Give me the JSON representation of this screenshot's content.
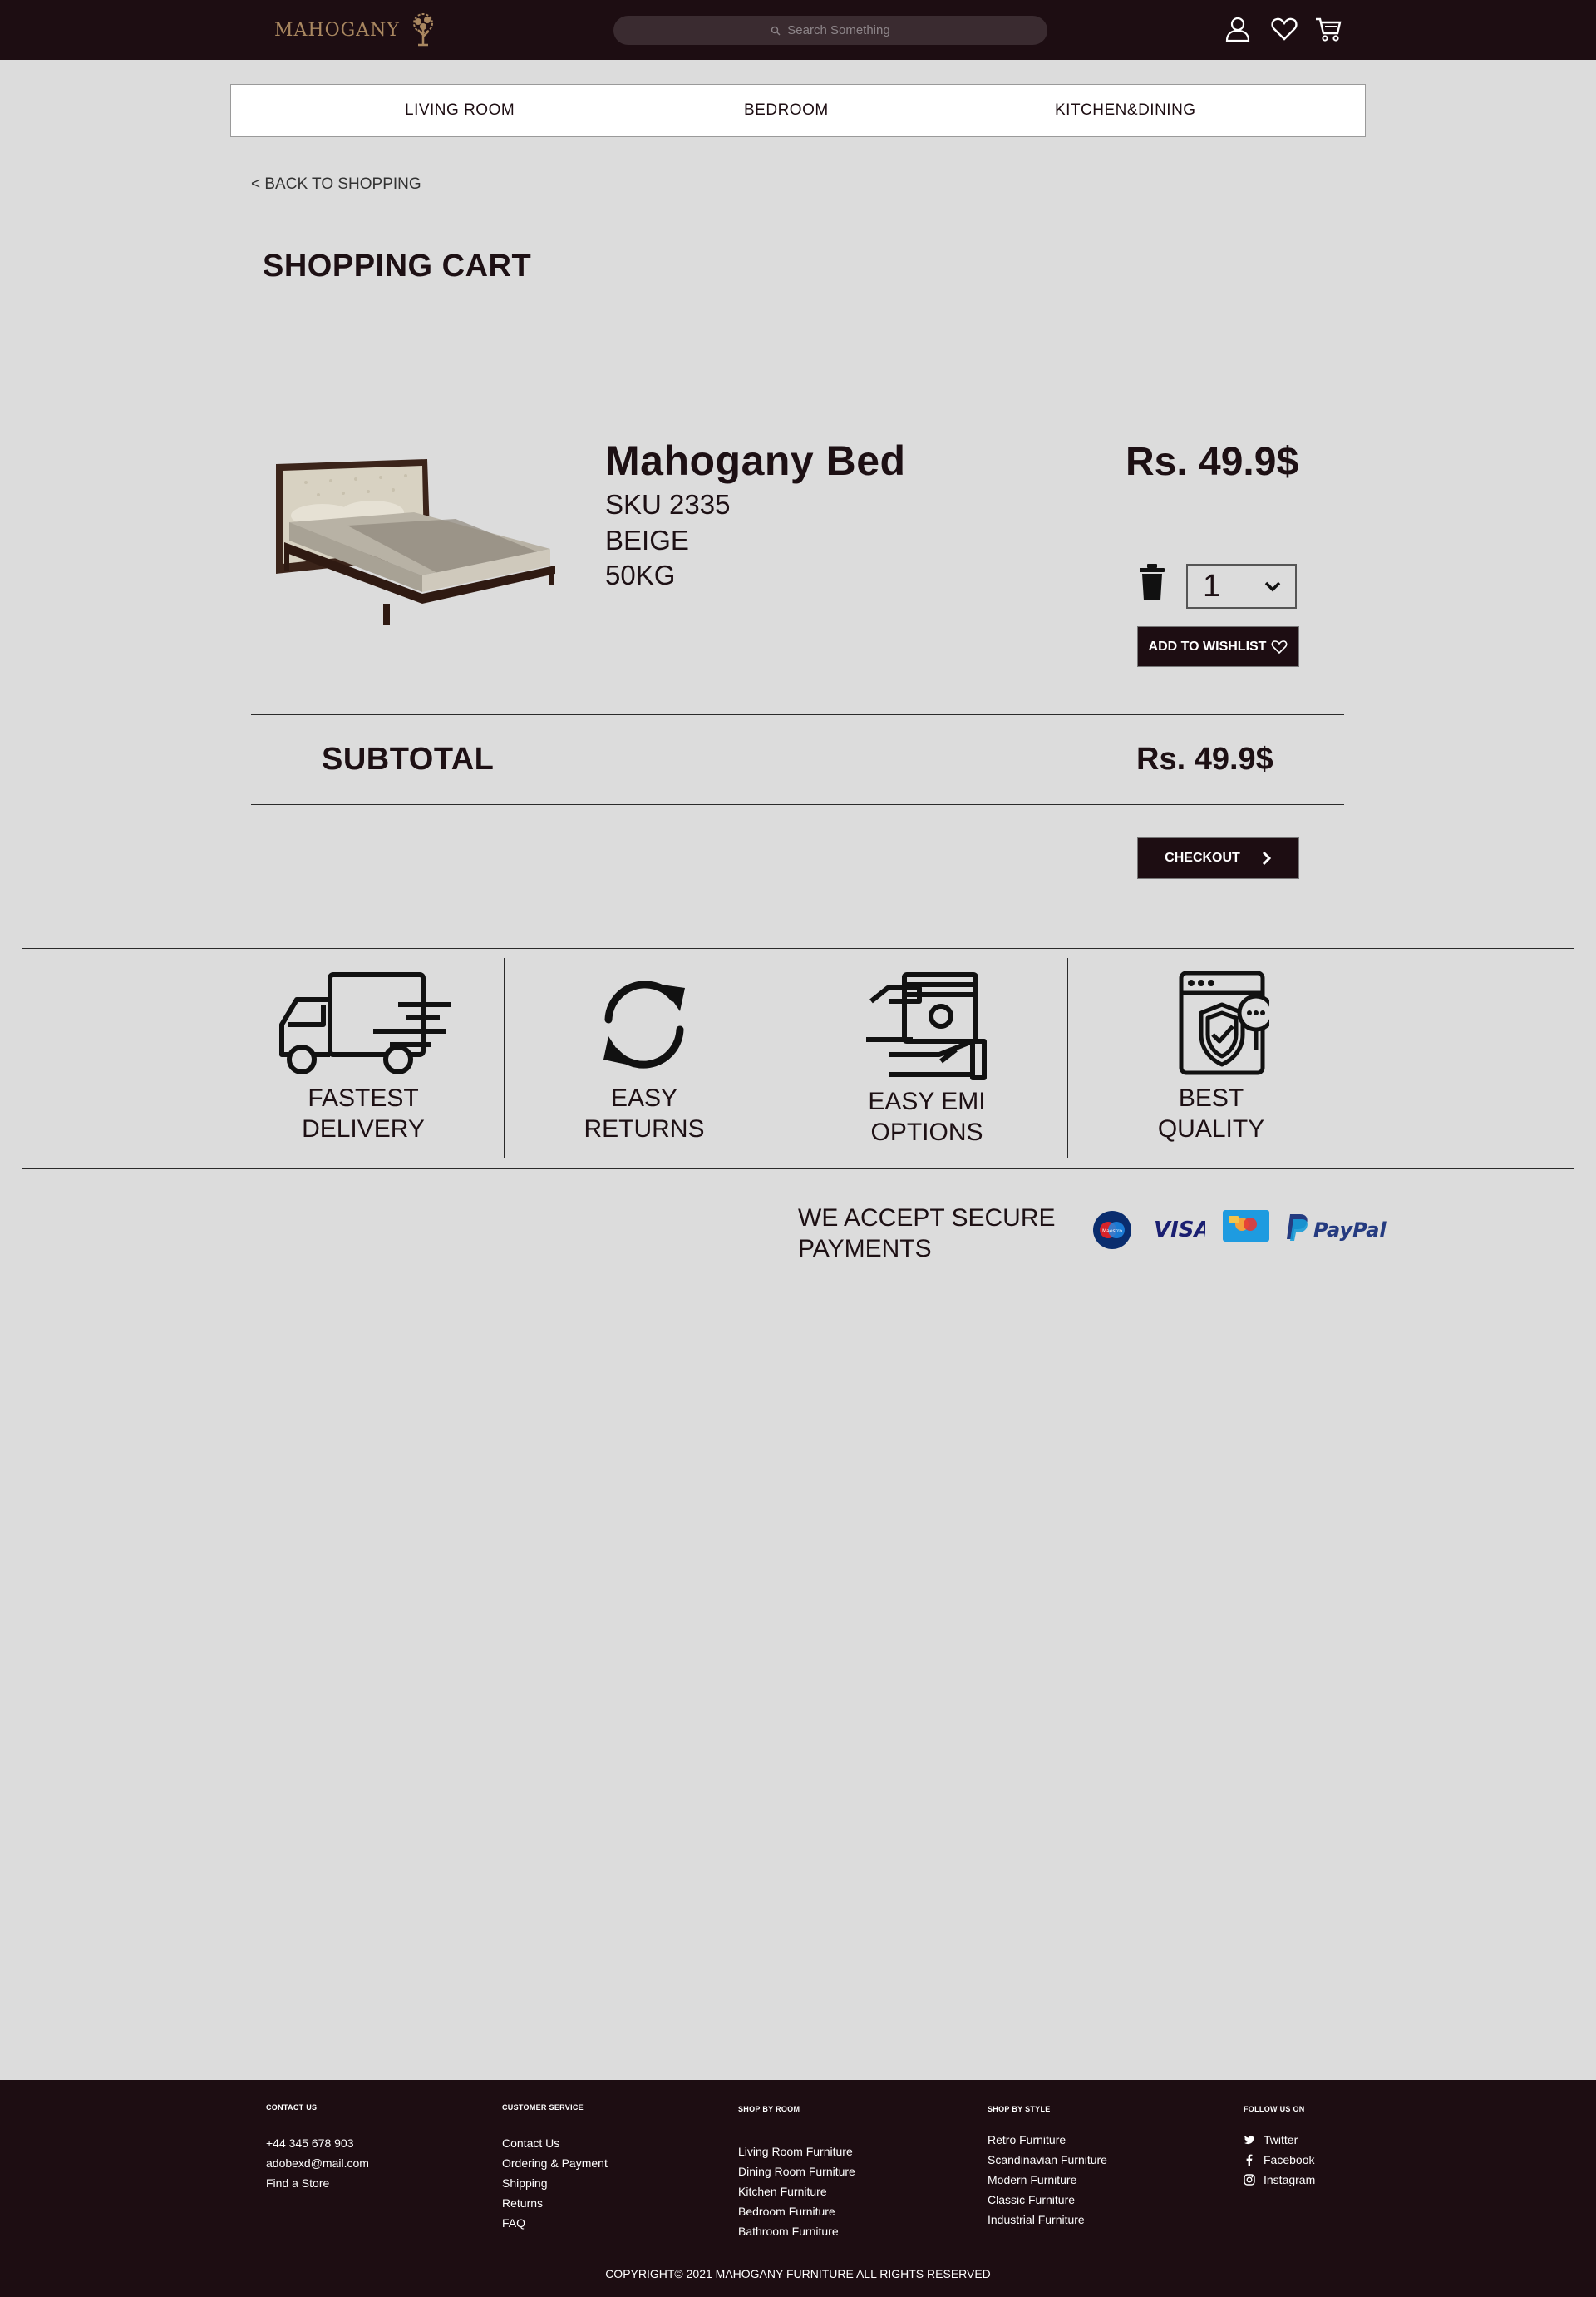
{
  "header": {
    "logo_text": "MAHOGANY",
    "search_placeholder": "Search Something"
  },
  "nav": {
    "items": [
      "LIVING ROOM",
      "BEDROOM",
      "KITCHEN&DINING"
    ]
  },
  "back_link": "< BACK TO SHOPPING",
  "page_title": "SHOPPING CART",
  "cart_item": {
    "name": "Mahogany Bed",
    "sku": "SKU 2335",
    "color": "BEIGE",
    "weight": "50KG",
    "price": "Rs. 49.9$",
    "quantity": "1",
    "wishlist_label": "ADD TO WISHLIST"
  },
  "subtotal": {
    "label": "SUBTOTAL",
    "value": "Rs. 49.9$"
  },
  "checkout_label": "CHECKOUT",
  "features": [
    {
      "icon": "delivery-truck-icon",
      "label": "FASTEST\nDELIVERY"
    },
    {
      "icon": "returns-icon",
      "label": "EASY\nRETURNS"
    },
    {
      "icon": "emi-cash-icon",
      "label": "EASY EMI\nOPTIONS"
    },
    {
      "icon": "quality-shield-icon",
      "label": "BEST\nQUALITY"
    }
  ],
  "payments": {
    "text": "WE ACCEPT SECURE\nPAYMENTS",
    "maestro_text": "Maestro",
    "visa_text": "VISA",
    "paypal_text": "PayPal"
  },
  "footer": {
    "contact": {
      "title": "CONTACT US",
      "items": [
        "+44 345 678 903",
        "adobexd@mail.com",
        "Find a Store"
      ]
    },
    "customer_service": {
      "title": "CUSTOMER SERVICE",
      "items": [
        "Contact Us",
        "Ordering & Payment",
        "Shipping",
        "Returns",
        "FAQ"
      ]
    },
    "shop_by_room": {
      "title": "SHOP BY ROOM",
      "items": [
        "Living Room Furniture",
        "Dining Room Furniture",
        "Kitchen Furniture",
        "Bedroom Furniture",
        "Bathroom Furniture"
      ]
    },
    "shop_by_style": {
      "title": "SHOP BY STYLE",
      "items": [
        "Retro Furniture",
        "Scandinavian Furniture",
        "Modern Furniture",
        "Classic Furniture",
        "Industrial Furniture"
      ]
    },
    "follow": {
      "title": "FOLLOW US ON",
      "items": [
        "Twitter",
        "Facebook",
        "Instagram"
      ]
    },
    "copyright": "COPYRIGHT© 2021 MAHOGANY FURNITURE ALL RIGHTS RESERVED"
  },
  "colors": {
    "brand_dark": "#1d0d12",
    "background": "#dcdcdc",
    "logo_gold": "#a98760"
  }
}
